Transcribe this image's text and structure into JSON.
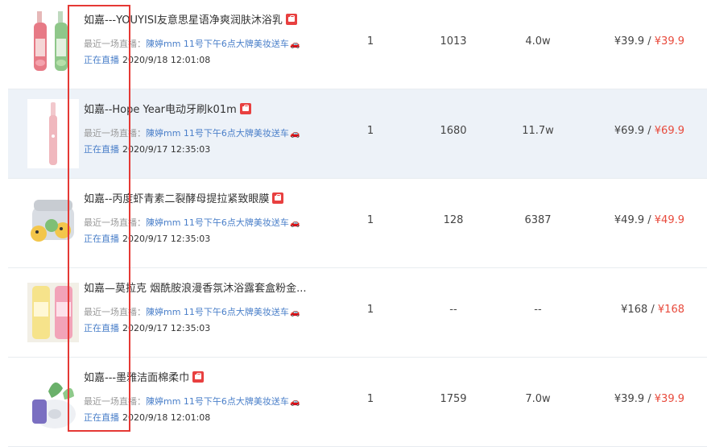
{
  "rows": [
    {
      "title": "如嘉---YOUYISI友意思星语净爽润肤沐浴乳",
      "recent_label": "最近一场直播：",
      "recent_link": "陳婷mm 11号下午6点大牌美妆送车",
      "status": "正在直播",
      "time": "2020/9/18 12:01:08",
      "col1": "1",
      "col2": "1013",
      "col3": "4.0w",
      "price": "¥39.9 /",
      "sale_price": "¥39.9",
      "thumb": "shower-gel-bottles"
    },
    {
      "title": "如嘉--Hope Year电动牙刷k01m",
      "recent_label": "最近一场直播：",
      "recent_link": "陳婷mm 11号下午6点大牌美妆送车",
      "status": "正在直播",
      "time": "2020/9/17 12:35:03",
      "col1": "1",
      "col2": "1680",
      "col3": "11.7w",
      "price": "¥69.9 /",
      "sale_price": "¥69.9",
      "thumb": "electric-toothbrush"
    },
    {
      "title": "如嘉--丙度虾青素二裂酵母提拉紧致眼膜",
      "recent_label": "最近一场直播：",
      "recent_link": "陳婷mm 11号下午6点大牌美妆送车",
      "status": "正在直播",
      "time": "2020/9/17 12:35:03",
      "col1": "1",
      "col2": "128",
      "col3": "6387",
      "price": "¥49.9 /",
      "sale_price": "¥49.9",
      "thumb": "eye-mask-jar"
    },
    {
      "title": "如嘉—莫拉克 烟酰胺浪漫香氛沐浴露套盒粉金...",
      "recent_label": "最近一场直播：",
      "recent_link": "陳婷mm 11号下午6点大牌美妆送车",
      "status": "正在直播",
      "time": "2020/9/17 12:35:03",
      "col1": "1",
      "col2": "--",
      "col3": "--",
      "price": "¥168 /",
      "sale_price": "¥168",
      "thumb": "body-wash-set"
    },
    {
      "title": "如嘉---墨雅洁面棉柔巾",
      "recent_label": "最近一场直播：",
      "recent_link": "陳婷mm 11号下午6点大牌美妆送车",
      "status": "正在直播",
      "time": "2020/9/18 12:01:08",
      "col1": "1",
      "col2": "1759",
      "col3": "7.0w",
      "price": "¥39.9 /",
      "sale_price": "¥39.9",
      "thumb": "cotton-towel-roll"
    }
  ],
  "colors": {
    "link": "#4a7fc9",
    "sale": "#e84a3c",
    "highlight": "#e53935",
    "alt_row": "#edf2f8"
  }
}
